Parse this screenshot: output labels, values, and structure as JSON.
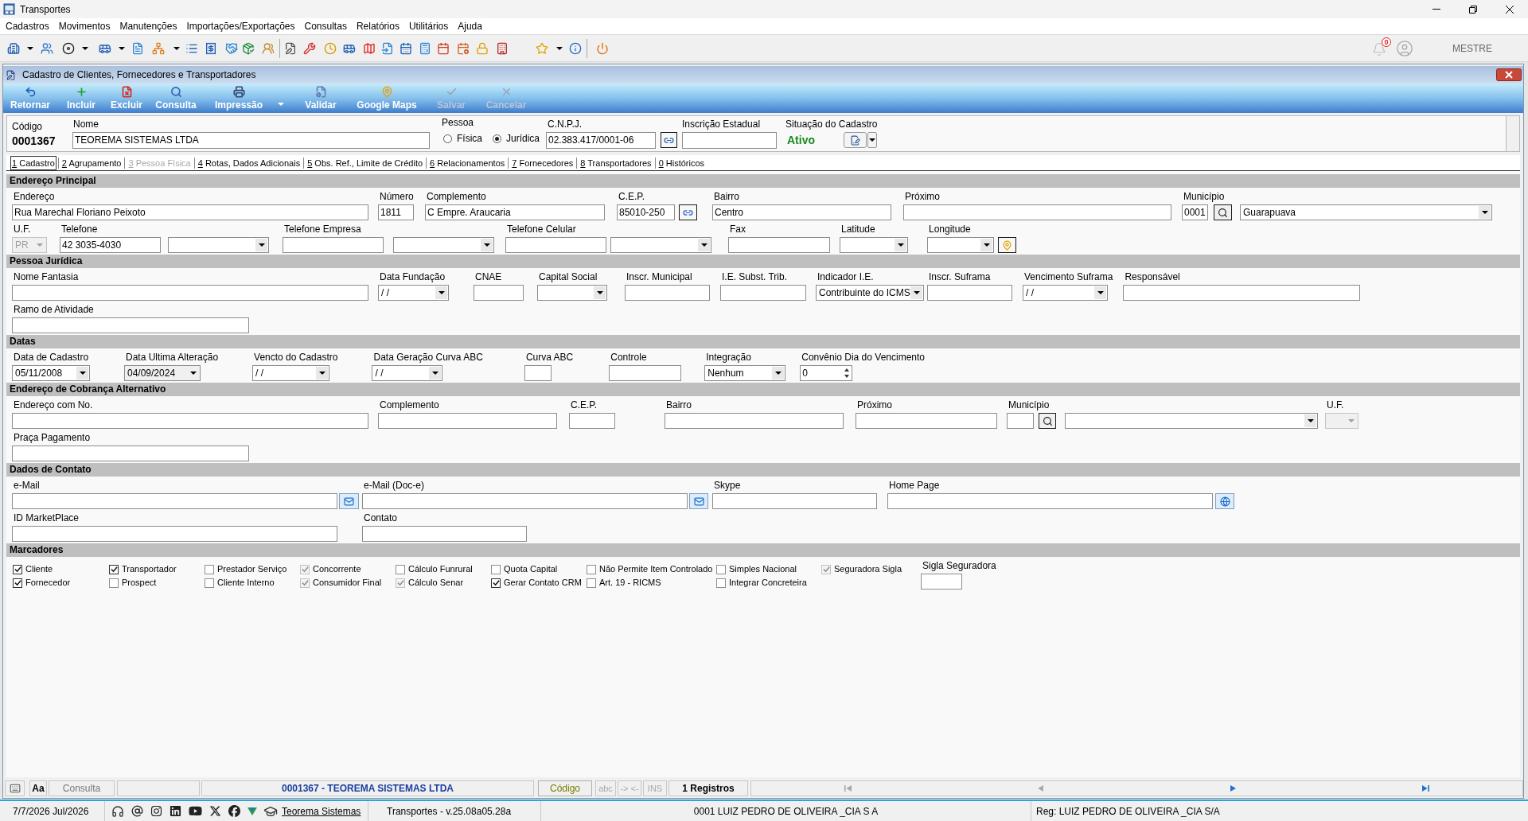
{
  "window": {
    "title": "Transportes"
  },
  "menu": [
    "Cadastros",
    "Movimentos",
    "Manutenções",
    "Importações/Exportações",
    "Consultas",
    "Relatórios",
    "Utilitários",
    "Ajuda"
  ],
  "toolbar": {
    "notifications": "0",
    "user": "MESTRE"
  },
  "form": {
    "title": "Cadastro de Clientes, Fornecedores e Transportadores",
    "actions": [
      {
        "label": "Retornar",
        "disabled": false,
        "has_menu": false
      },
      {
        "label": "Incluir",
        "disabled": false,
        "has_menu": false
      },
      {
        "label": "Excluir",
        "disabled": false,
        "has_menu": false
      },
      {
        "label": "Consulta",
        "disabled": false,
        "has_menu": false
      },
      {
        "label": "Impressão",
        "disabled": false,
        "has_menu": true
      },
      {
        "label": "Validar",
        "disabled": false,
        "has_menu": false
      },
      {
        "label": "Google Maps",
        "disabled": false,
        "has_menu": false
      },
      {
        "label": "Salvar",
        "disabled": true,
        "has_menu": false
      },
      {
        "label": "Cancelar",
        "disabled": true,
        "has_menu": false
      }
    ],
    "header": {
      "code": {
        "label": "Código",
        "value": "0001367"
      },
      "name": {
        "label": "Nome",
        "value": "TEOREMA SISTEMAS LTDA"
      },
      "person_type": {
        "label": "Pessoa",
        "options": [
          {
            "label": "Física",
            "selected": false
          },
          {
            "label": "Jurídica",
            "selected": true
          }
        ]
      },
      "cnpj": {
        "label": "C.N.P.J.",
        "value": "02.383.417/0001-06",
        "button": {
          "kind": "locate"
        }
      },
      "state_registration": {
        "label": "Inscrição Estadual"
      },
      "status": {
        "label": "Situação do Cadastro",
        "value": "Ativo"
      }
    },
    "tabs": [
      {
        "key": "1",
        "label": "Cadastro",
        "selected": true,
        "disabled": false
      },
      {
        "key": "2",
        "label": "Agrupamento",
        "selected": false,
        "disabled": false
      },
      {
        "key": "3",
        "label": "Pessoa Física",
        "selected": false,
        "disabled": true
      },
      {
        "key": "4",
        "label": "Rotas, Dados Adicionais",
        "selected": false,
        "disabled": false
      },
      {
        "key": "5",
        "label": "Obs. Ref., Limite de Crédito",
        "selected": false,
        "disabled": false
      },
      {
        "key": "6",
        "label": "Relacionamentos",
        "selected": false,
        "disabled": false
      },
      {
        "key": "7",
        "label": "Fornecedores",
        "selected": false,
        "disabled": false
      },
      {
        "key": "8",
        "label": "Transportadores",
        "selected": false,
        "disabled": false
      },
      {
        "key": "0",
        "label": "Históricos",
        "selected": false,
        "disabled": false
      }
    ],
    "sections": [
      {
        "title": "Endereço Principal",
        "fields": [
          {
            "label": "Endereço",
            "kind": "text",
            "value": "Rua Marechal Floriano Peixoto",
            "disabled": false,
            "readonly": false
          },
          {
            "label": "Número",
            "kind": "text",
            "value": "1811",
            "disabled": false,
            "readonly": false
          },
          {
            "label": "Complemento",
            "kind": "text",
            "value": "C Empre. Araucaria",
            "disabled": false,
            "readonly": false
          },
          {
            "label": "C.E.P.",
            "kind": "text",
            "value": "85010-250",
            "disabled": false,
            "readonly": false,
            "button": {
              "kind": "locate"
            }
          },
          {
            "label": "Bairro",
            "kind": "text",
            "value": "Centro",
            "disabled": false,
            "readonly": false
          },
          {
            "label": "Próximo",
            "kind": "text",
            "disabled": false,
            "readonly": false
          },
          {
            "label": "Município",
            "kind": "text",
            "value": "0001",
            "disabled": false,
            "readonly": false,
            "button": {
              "kind": "search"
            }
          },
          {
            "kind": "combo",
            "value": "Guarapuava",
            "disabled": false,
            "readonly": false
          },
          {
            "label": "U.F.",
            "kind": "combo",
            "value": "PR",
            "disabled": true,
            "readonly": false
          },
          {
            "label": "Telefone",
            "kind": "text",
            "value": "42 3035-4030",
            "disabled": false,
            "readonly": false
          },
          {
            "kind": "combo",
            "disabled": false,
            "readonly": false
          },
          {
            "label": "Telefone Empresa",
            "kind": "text",
            "disabled": false,
            "readonly": false
          },
          {
            "kind": "combo",
            "disabled": false,
            "readonly": false
          },
          {
            "label": "Telefone Celular",
            "kind": "text",
            "disabled": false,
            "readonly": false
          },
          {
            "kind": "combo",
            "disabled": false,
            "readonly": false
          },
          {
            "label": "Fax",
            "kind": "text",
            "disabled": false,
            "readonly": false
          },
          {
            "label": "Latitude",
            "kind": "combo",
            "disabled": false,
            "readonly": false
          },
          {
            "label": "Longitude",
            "kind": "combo",
            "disabled": false,
            "readonly": false,
            "button": {
              "kind": "pin"
            }
          }
        ]
      },
      {
        "title": "Pessoa Jurídica",
        "fields": [
          {
            "label": "Nome Fantasia",
            "kind": "text",
            "disabled": false,
            "readonly": false
          },
          {
            "label": "Data Fundação",
            "kind": "combo",
            "value": "/ /",
            "disabled": false,
            "readonly": false
          },
          {
            "label": "CNAE",
            "kind": "text",
            "disabled": false,
            "readonly": false
          },
          {
            "label": "Capital Social",
            "kind": "combo",
            "disabled": false,
            "readonly": false
          },
          {
            "label": "Inscr. Municipal",
            "kind": "text",
            "disabled": false,
            "readonly": false
          },
          {
            "label": "I.E. Subst. Trib.",
            "kind": "text",
            "disabled": false,
            "readonly": false
          },
          {
            "label": "Indicador I.E.",
            "kind": "combo",
            "value": "Contribuinte do ICMS",
            "disabled": false,
            "readonly": false
          },
          {
            "label": "Inscr. Suframa",
            "kind": "text",
            "disabled": false,
            "readonly": false
          },
          {
            "label": "Vencimento Suframa",
            "kind": "combo",
            "value": "/ /",
            "disabled": false,
            "readonly": false
          },
          {
            "label": "Responsável",
            "kind": "text",
            "disabled": false,
            "readonly": false
          },
          {
            "label": "Ramo de Atividade",
            "kind": "text",
            "disabled": false,
            "readonly": false
          }
        ]
      },
      {
        "title": "Datas",
        "fields": [
          {
            "label": "Data de Cadastro",
            "kind": "combo",
            "value": "05/11/2008",
            "disabled": false,
            "readonly": false
          },
          {
            "label": "Data Ultima Alteração",
            "kind": "combo",
            "value": "04/09/2024",
            "disabled": false,
            "readonly": true
          },
          {
            "label": "Vencto do Cadastro",
            "kind": "combo",
            "value": "/ /",
            "disabled": false,
            "readonly": false
          },
          {
            "label": "Data Geração Curva ABC",
            "kind": "combo",
            "value": "/ /",
            "disabled": false,
            "readonly": false
          },
          {
            "label": "Curva ABC",
            "kind": "text",
            "disabled": false,
            "readonly": false
          },
          {
            "label": "Controle",
            "kind": "text",
            "disabled": false,
            "readonly": false
          },
          {
            "label": "Integração",
            "kind": "combo",
            "value": "Nenhum",
            "disabled": false,
            "readonly": false
          },
          {
            "label": "Convênio Dia do Vencimento",
            "kind": "spin",
            "value": "0",
            "disabled": false,
            "readonly": false
          }
        ]
      },
      {
        "title": "Endereço de Cobrança Alternativo",
        "fields": [
          {
            "label": "Endereço com No.",
            "kind": "text",
            "disabled": false,
            "readonly": false
          },
          {
            "label": "Complemento",
            "kind": "text",
            "disabled": false,
            "readonly": false
          },
          {
            "label": "C.E.P.",
            "kind": "text",
            "disabled": false,
            "readonly": false
          },
          {
            "label": "Bairro",
            "kind": "text",
            "disabled": false,
            "readonly": false
          },
          {
            "label": "Próximo",
            "kind": "text",
            "disabled": false,
            "readonly": false
          },
          {
            "label": "Município",
            "kind": "text",
            "disabled": false,
            "readonly": false,
            "button": {
              "kind": "search"
            }
          },
          {
            "kind": "combo",
            "disabled": false,
            "readonly": false
          },
          {
            "label": "U.F.",
            "kind": "combo",
            "disabled": true,
            "readonly": false
          },
          {
            "label": "Praça Pagamento",
            "kind": "text",
            "disabled": false,
            "readonly": false
          }
        ]
      },
      {
        "title": "Dados de Contato",
        "fields": [
          {
            "label": "e-Mail",
            "kind": "text",
            "disabled": false,
            "readonly": false,
            "button": {
              "kind": "mail"
            }
          },
          {
            "label": "e-Mail (Doc-e)",
            "kind": "text",
            "disabled": false,
            "readonly": false,
            "button": {
              "kind": "mail"
            }
          },
          {
            "label": "Skype",
            "kind": "text",
            "disabled": false,
            "readonly": false
          },
          {
            "label": "Home Page",
            "kind": "text",
            "disabled": false,
            "readonly": false,
            "button": {
              "kind": "browser"
            }
          },
          {
            "label": "ID MarketPlace",
            "kind": "text",
            "disabled": false,
            "readonly": false
          },
          {
            "label": "Contato",
            "kind": "text",
            "disabled": false,
            "readonly": false
          }
        ]
      },
      {
        "title": "Marcadores",
        "checkboxes": [
          {
            "label": "Cliente",
            "checked": true,
            "disabled": false
          },
          {
            "label": "Transportador",
            "checked": true,
            "disabled": false
          },
          {
            "label": "Prestador Serviço",
            "checked": false,
            "disabled": false
          },
          {
            "label": "Concorrente",
            "checked": true,
            "disabled": true
          },
          {
            "label": "Cálculo Funrural",
            "checked": false,
            "disabled": false
          },
          {
            "label": "Quota Capital",
            "checked": false,
            "disabled": false
          },
          {
            "label": "Não Permite Item Controlado",
            "checked": false,
            "disabled": false
          },
          {
            "label": "Simples Nacional",
            "checked": false,
            "disabled": false
          },
          {
            "label": "Seguradora Sigla",
            "checked": true,
            "disabled": true
          },
          {
            "label": "Fornecedor",
            "checked": true,
            "disabled": false
          },
          {
            "label": "Prospect",
            "checked": false,
            "disabled": false
          },
          {
            "label": "Cliente Interno",
            "checked": false,
            "disabled": false
          },
          {
            "label": "Consumidor Final",
            "checked": true,
            "disabled": true
          },
          {
            "label": "Cálculo Senar",
            "checked": true,
            "disabled": true
          },
          {
            "label": "Gerar Contato CRM",
            "checked": true,
            "disabled": false
          },
          {
            "label": "Art. 19 - RICMS",
            "checked": false,
            "disabled": false
          },
          {
            "label": "Integrar Concreteira",
            "checked": false,
            "disabled": false
          }
        ],
        "fields": [
          {
            "label": "Sigla Seguradora",
            "kind": "text",
            "disabled": false,
            "readonly": false
          }
        ]
      }
    ],
    "record_bar": {
      "font_button": "Aa",
      "mode": "Consulta",
      "record": "0001367 - TEOREMA SISTEMAS LTDA",
      "order": "Código",
      "indicators": [
        {
          "label": "abc",
          "on": false
        },
        {
          "label": "-> <-",
          "on": false
        },
        {
          "label": "INS",
          "on": false
        }
      ],
      "count": "1 Registros",
      "navigator": [
        {
          "kind": "first",
          "disabled": true
        },
        {
          "kind": "prev",
          "disabled": true
        },
        {
          "kind": "next",
          "disabled": false
        },
        {
          "kind": "last",
          "disabled": false
        }
      ]
    }
  },
  "status_bar": {
    "date": "7/7/2026 Jul/2026",
    "link": "Teorema Sistemas",
    "version": "Transportes - v.25.08a05.28a",
    "company": "0001 LUIZ PEDRO DE OLIVEIRA _CIA S A",
    "registration": "Reg: LUIZ PEDRO DE OLIVEIRA _CIA S/A"
  }
}
